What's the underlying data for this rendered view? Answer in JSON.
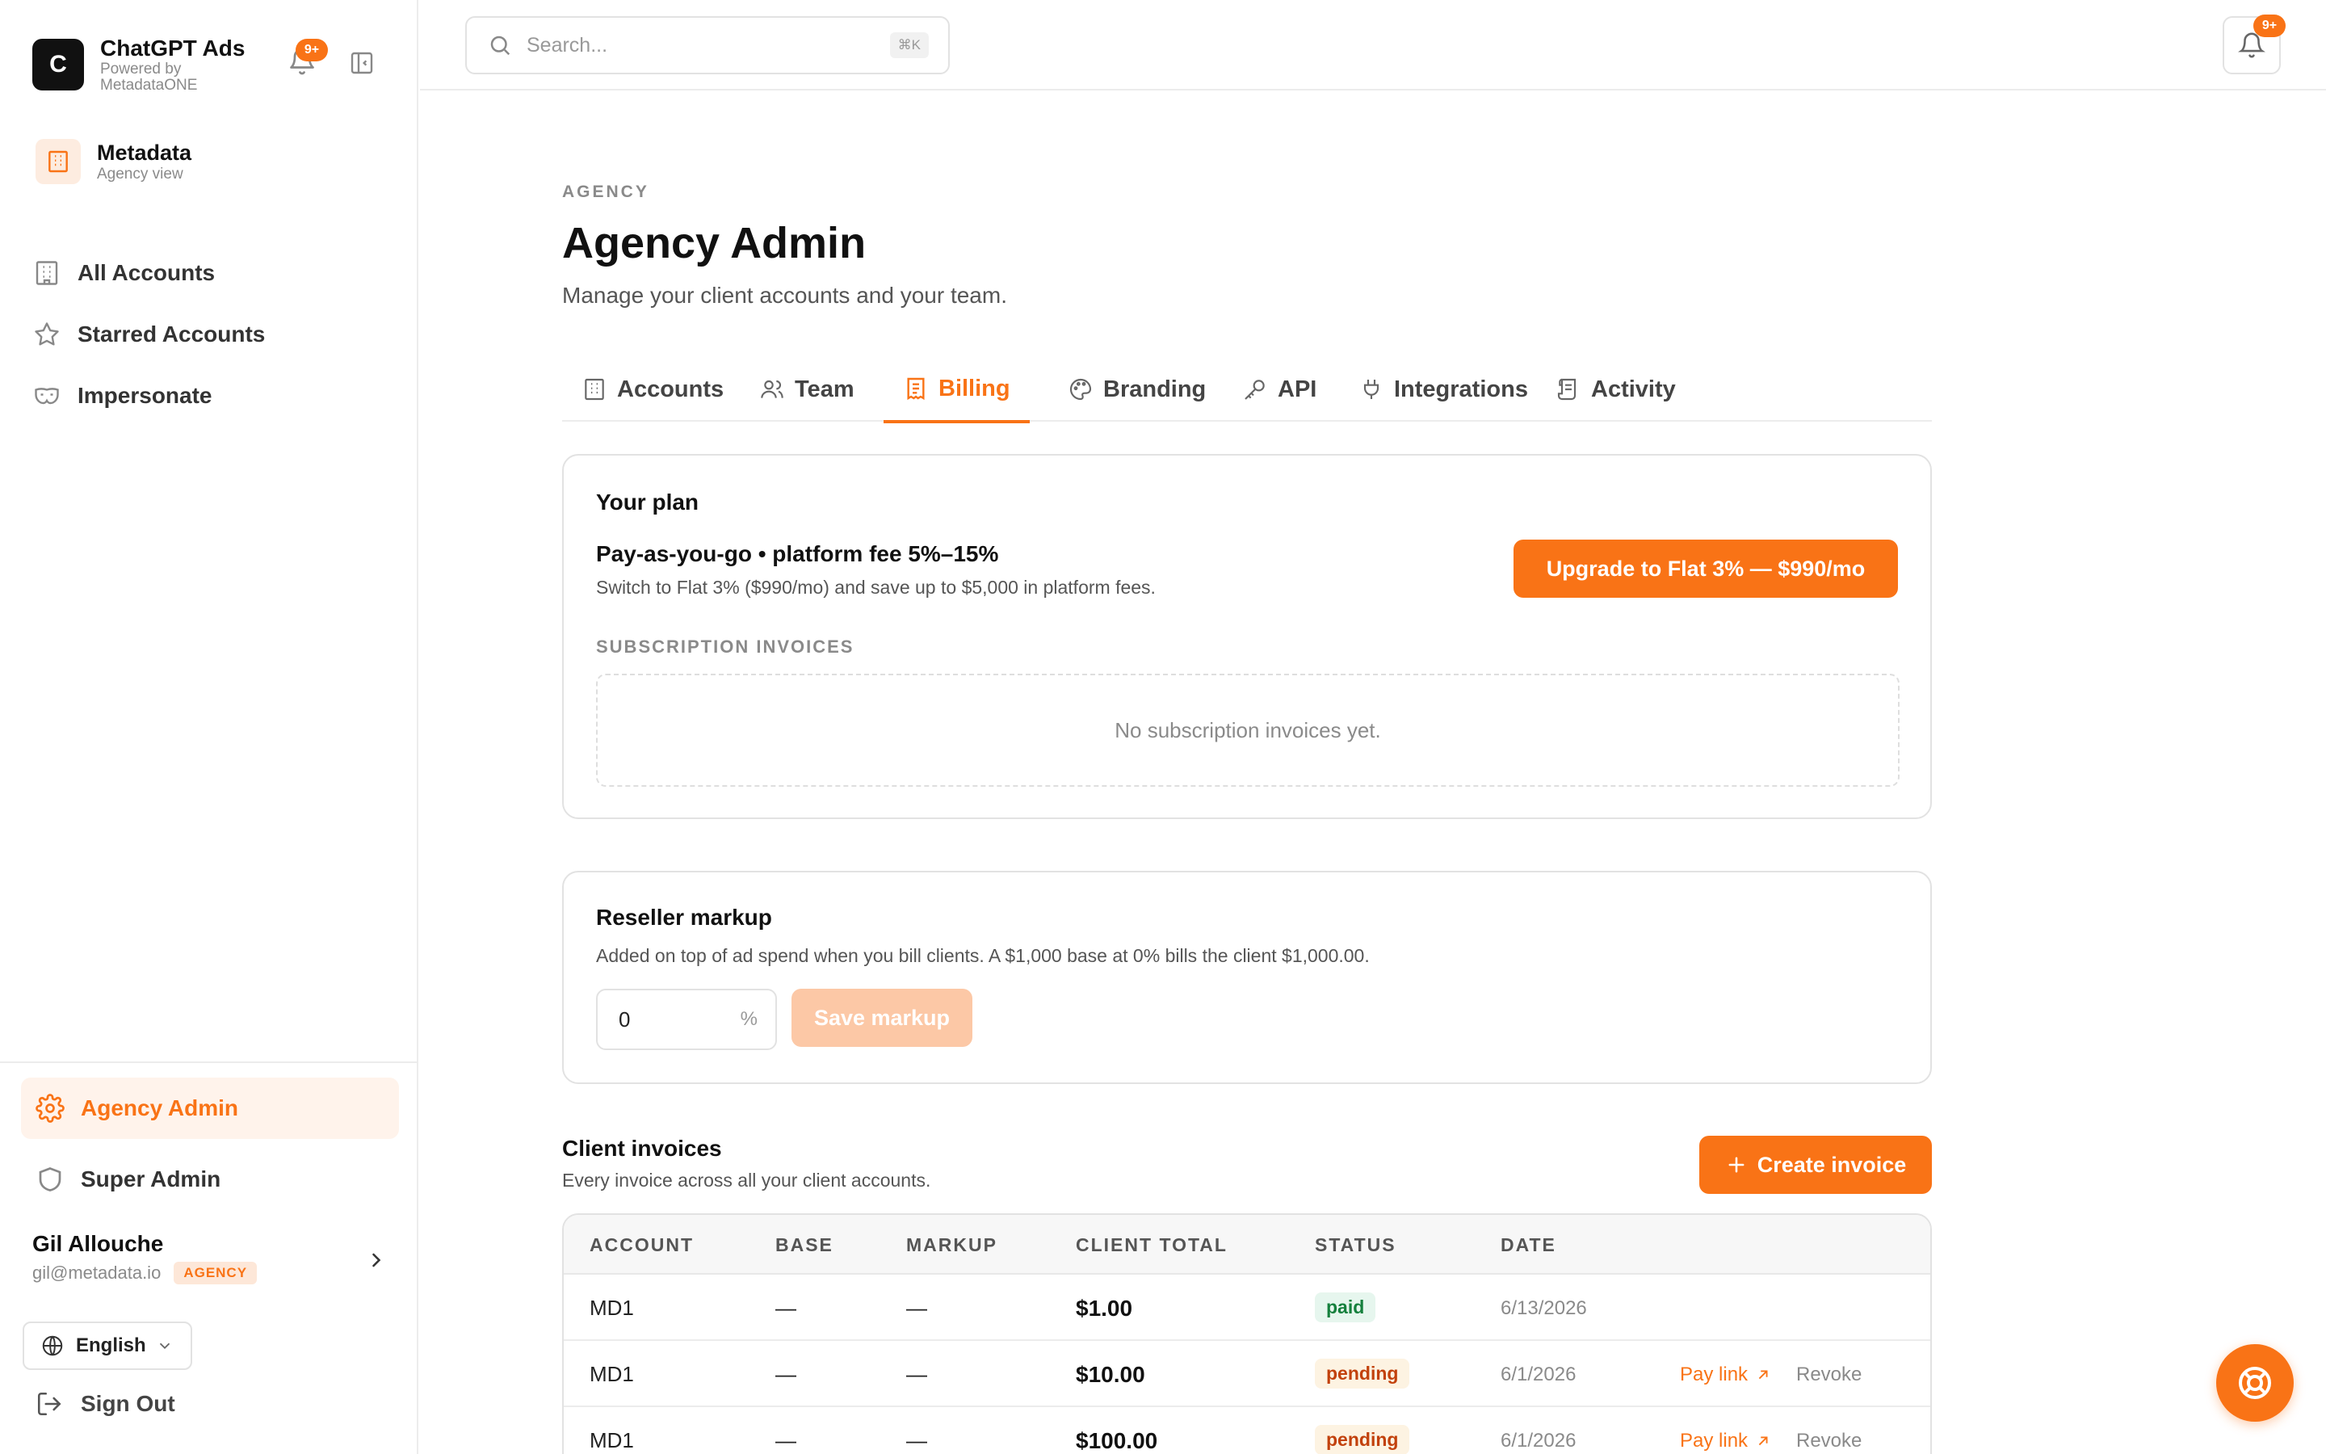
{
  "app": {
    "logo_letter": "C",
    "name": "ChatGPT Ads",
    "powered_by": "Powered by MetadataONE",
    "notifications_badge": "9+"
  },
  "org": {
    "name": "Metadata",
    "view": "Agency view"
  },
  "sidebar": {
    "items": [
      {
        "label": "All Accounts",
        "icon": "building-icon"
      },
      {
        "label": "Starred Accounts",
        "icon": "star-icon"
      },
      {
        "label": "Impersonate",
        "icon": "mask-icon"
      }
    ],
    "bottom_items": [
      {
        "label": "Agency Admin",
        "icon": "gear-icon",
        "active": true
      },
      {
        "label": "Super Admin",
        "icon": "shield-icon",
        "active": false
      }
    ],
    "user": {
      "name": "Gil Allouche",
      "email": "gil@metadata.io",
      "role": "AGENCY"
    },
    "language": "English",
    "sign_out": "Sign Out"
  },
  "topbar": {
    "search_placeholder": "Search...",
    "shortcut": "⌘K",
    "notifications_badge": "9+"
  },
  "page": {
    "eyebrow": "AGENCY",
    "title": "Agency Admin",
    "subtitle": "Manage your client accounts and your team."
  },
  "tabs": [
    {
      "label": "Accounts",
      "icon": "building-icon"
    },
    {
      "label": "Team",
      "icon": "users-icon"
    },
    {
      "label": "Billing",
      "icon": "receipt-icon",
      "active": true
    },
    {
      "label": "Branding",
      "icon": "palette-icon"
    },
    {
      "label": "API",
      "icon": "key-icon"
    },
    {
      "label": "Integrations",
      "icon": "plug-icon"
    },
    {
      "label": "Activity",
      "icon": "scroll-icon"
    }
  ],
  "plan": {
    "title": "Your plan",
    "name": "Pay-as-you-go • platform fee 5%–15%",
    "description": "Switch to Flat 3% ($990/mo) and save up to $5,000 in platform fees.",
    "upgrade_button": "Upgrade to Flat 3% — $990/mo",
    "invoices_label": "SUBSCRIPTION INVOICES",
    "empty_text": "No subscription invoices yet."
  },
  "markup": {
    "title": "Reseller markup",
    "description": "Added on top of ad spend when you bill clients. A $1,000 base at 0% bills the client $1,000.00.",
    "value": "0",
    "unit": "%",
    "save_button": "Save markup"
  },
  "client_invoices": {
    "title": "Client invoices",
    "subtitle": "Every invoice across all your client accounts.",
    "create_button": "Create invoice",
    "columns": [
      "ACCOUNT",
      "BASE",
      "MARKUP",
      "CLIENT TOTAL",
      "STATUS",
      "DATE"
    ],
    "rows": [
      {
        "account": "MD1",
        "base": "—",
        "markup": "—",
        "total": "$1.00",
        "status": "paid",
        "date": "6/13/2026",
        "pay_link": "",
        "revoke": ""
      },
      {
        "account": "MD1",
        "base": "—",
        "markup": "—",
        "total": "$10.00",
        "status": "pending",
        "date": "6/1/2026",
        "pay_link": "Pay link",
        "revoke": "Revoke"
      },
      {
        "account": "MD1",
        "base": "—",
        "markup": "—",
        "total": "$100.00",
        "status": "pending",
        "date": "6/1/2026",
        "pay_link": "Pay link",
        "revoke": "Revoke"
      }
    ]
  },
  "colors": {
    "accent": "#f97316",
    "accent_soft": "#fff3eb",
    "paid": "#15803d",
    "pending": "#c2410c"
  }
}
